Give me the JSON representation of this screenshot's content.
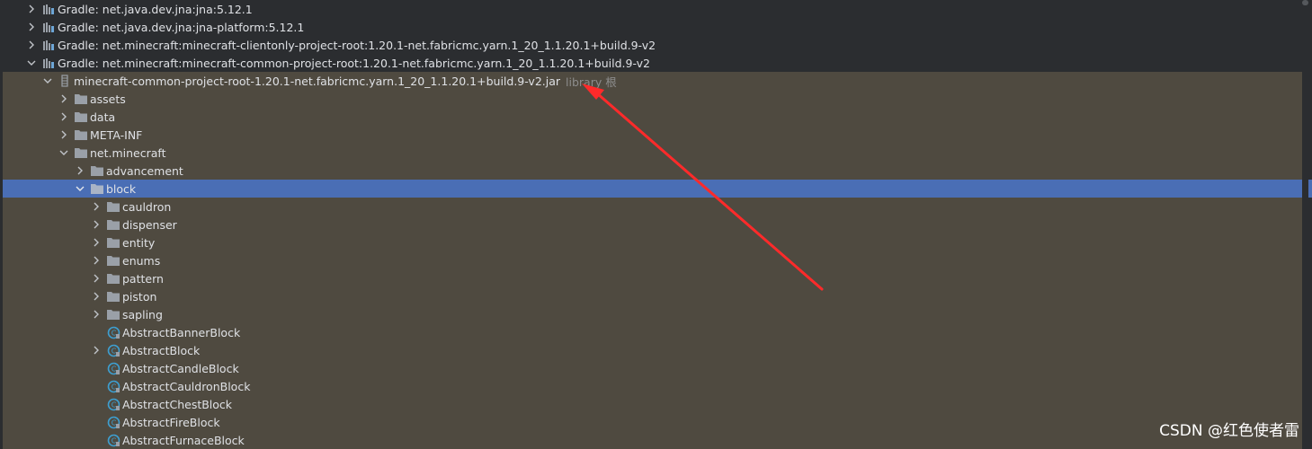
{
  "colors": {
    "background": "#2b2d30",
    "library_bg": "#4f4a40",
    "selection": "#4a6eb5",
    "text": "#dfe1e5",
    "hint": "#8c8c8c",
    "folder": "#9aa0a8",
    "class_icon": "#3d9fd1",
    "annotation_arrow": "#ff2a2a"
  },
  "tree": {
    "gradle_rows": [
      {
        "label": "Gradle: net.java.dev.jna:jna:5.12.1",
        "expanded": false,
        "icon": "library-icon"
      },
      {
        "label": "Gradle: net.java.dev.jna:jna-platform:5.12.1",
        "expanded": false,
        "icon": "library-icon"
      },
      {
        "label": "Gradle: net.minecraft:minecraft-clientonly-project-root:1.20.1-net.fabricmc.yarn.1_20_1.1.20.1+build.9-v2",
        "expanded": false,
        "icon": "library-icon"
      },
      {
        "label": "Gradle: net.minecraft:minecraft-common-project-root:1.20.1-net.fabricmc.yarn.1_20_1.1.20.1+build.9-v2",
        "expanded": true,
        "icon": "library-icon"
      }
    ],
    "jar": {
      "label": "minecraft-common-project-root-1.20.1-net.fabricmc.yarn.1_20_1.1.20.1+build.9-v2.jar",
      "hint": "library 根",
      "icon": "jar-icon"
    },
    "root_folders": [
      {
        "label": "assets"
      },
      {
        "label": "data"
      },
      {
        "label": "META-INF"
      }
    ],
    "package": {
      "label": "net.minecraft"
    },
    "package_children": [
      {
        "label": "advancement"
      }
    ],
    "selected": {
      "label": "block"
    },
    "block_folders": [
      {
        "label": "cauldron"
      },
      {
        "label": "dispenser"
      },
      {
        "label": "entity"
      },
      {
        "label": "enums"
      },
      {
        "label": "pattern"
      },
      {
        "label": "piston"
      },
      {
        "label": "sapling"
      }
    ],
    "block_classes": [
      {
        "label": "AbstractBannerBlock",
        "expandable": false
      },
      {
        "label": "AbstractBlock",
        "expandable": true
      },
      {
        "label": "AbstractCandleBlock",
        "expandable": false
      },
      {
        "label": "AbstractCauldronBlock",
        "expandable": false
      },
      {
        "label": "AbstractChestBlock",
        "expandable": false
      },
      {
        "label": "AbstractFireBlock",
        "expandable": false
      },
      {
        "label": "AbstractFurnaceBlock",
        "expandable": false
      }
    ]
  },
  "watermark": "CSDN @红色使者雷"
}
